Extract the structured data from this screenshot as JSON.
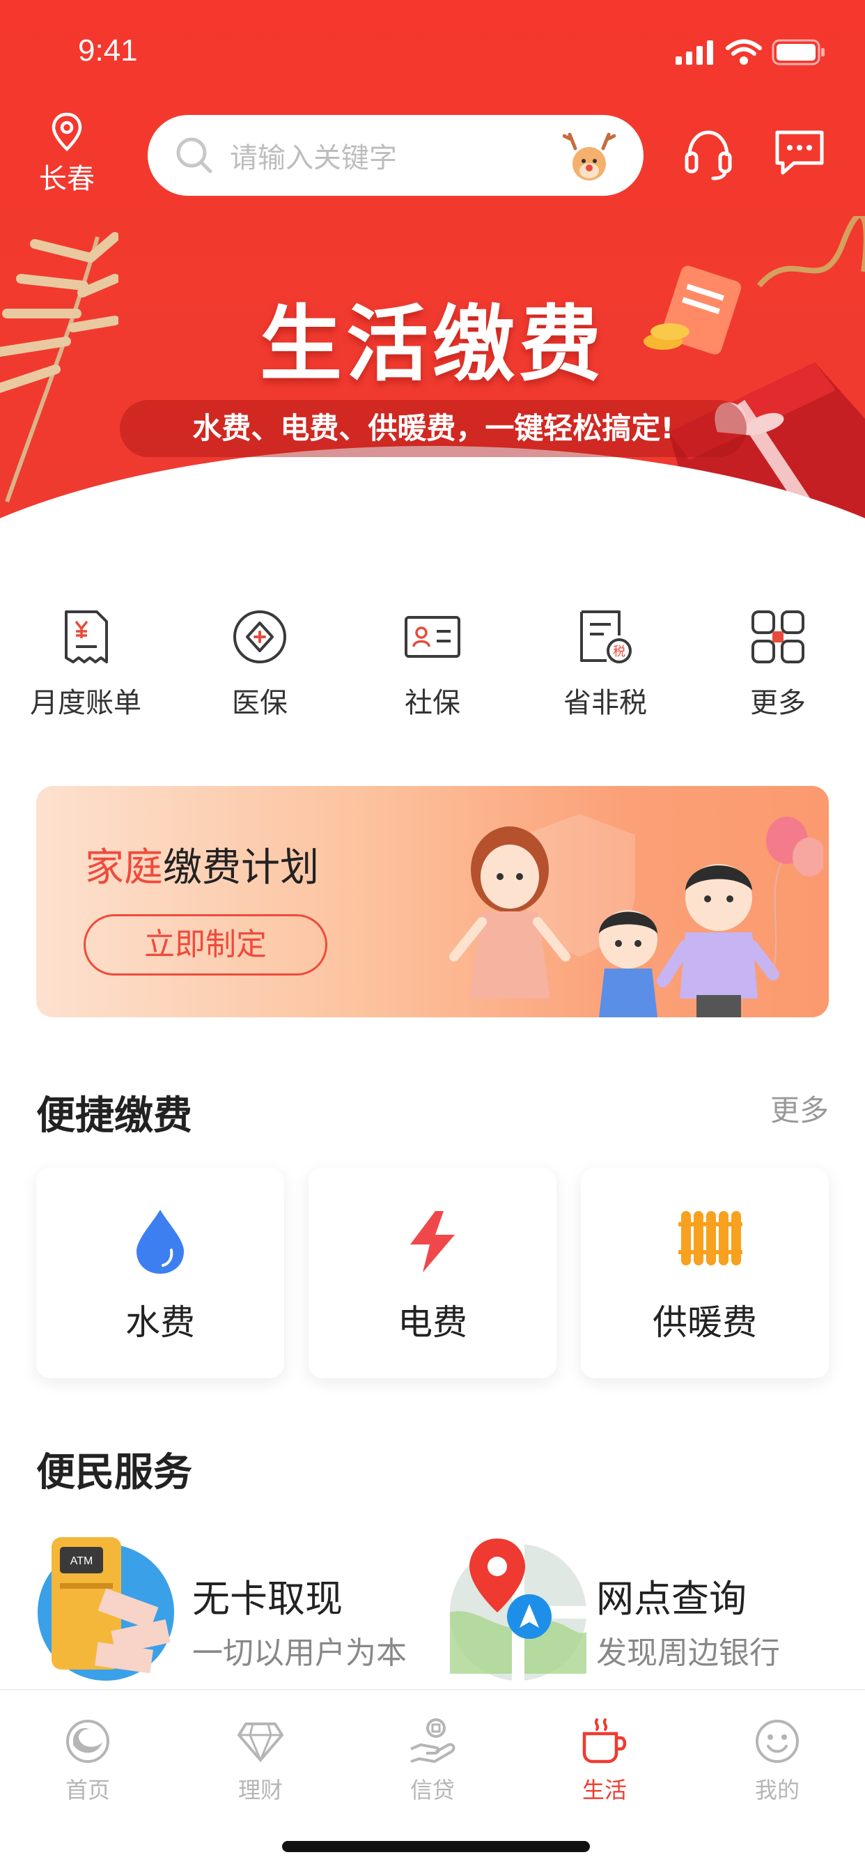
{
  "status_bar": {
    "time": "9:41"
  },
  "header": {
    "location": "长春",
    "search_placeholder": "请输入关键字"
  },
  "hero": {
    "title": "生活缴费",
    "subtitle": "水费、电费、供暖费，一键轻松搞定!"
  },
  "quick_actions": [
    {
      "label": "月度账单",
      "icon": "bill-icon"
    },
    {
      "label": "医保",
      "icon": "medical-insurance-icon"
    },
    {
      "label": "社保",
      "icon": "social-security-card-icon"
    },
    {
      "label": "省非税",
      "icon": "tax-document-icon"
    },
    {
      "label": "更多",
      "icon": "grid-more-icon"
    }
  ],
  "family_plan": {
    "title_highlight": "家庭",
    "title_rest": "缴费计划",
    "button": "立即制定"
  },
  "quick_pay": {
    "title": "便捷缴费",
    "more": "更多",
    "items": [
      {
        "label": "水费",
        "icon": "water-drop-icon",
        "color": "#3d7ff0"
      },
      {
        "label": "电费",
        "icon": "lightning-icon",
        "color": "#f0484a"
      },
      {
        "label": "供暖费",
        "icon": "radiator-icon",
        "color": "#f7a11f"
      }
    ]
  },
  "services": {
    "title": "便民服务",
    "items": [
      {
        "title": "无卡取现",
        "desc": "一切以用户为本",
        "icon": "atm-icon"
      },
      {
        "title": "网点查询",
        "desc": "发现周边银行",
        "icon": "map-pin-icon"
      }
    ]
  },
  "tabbar": {
    "items": [
      {
        "label": "首页",
        "icon": "home-icon",
        "active": false
      },
      {
        "label": "理财",
        "icon": "diamond-icon",
        "active": false
      },
      {
        "label": "信贷",
        "icon": "loan-hand-icon",
        "active": false
      },
      {
        "label": "生活",
        "icon": "cup-icon",
        "active": true
      },
      {
        "label": "我的",
        "icon": "smile-icon",
        "active": false
      }
    ]
  },
  "colors": {
    "brand_red": "#f13a2f",
    "accent_red": "#ef4a3c"
  }
}
